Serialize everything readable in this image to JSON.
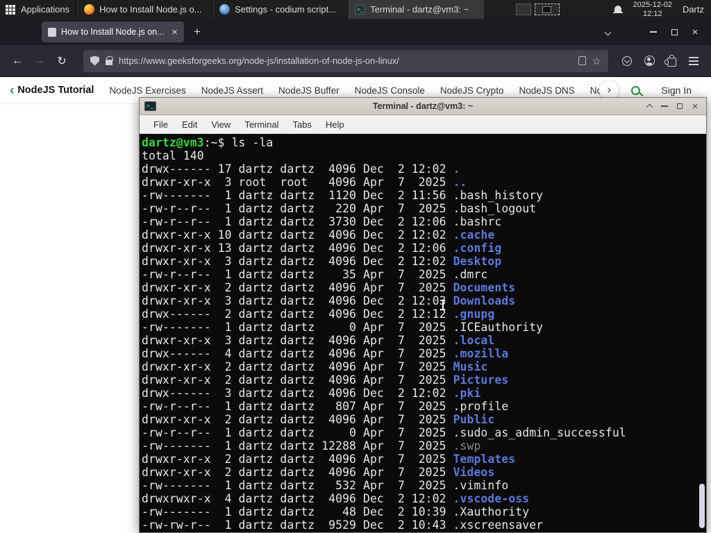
{
  "panel": {
    "applications": "Applications",
    "tasks": [
      {
        "icon": "firefox",
        "label": "How to Install Node.js o...",
        "active": false
      },
      {
        "icon": "settings",
        "label": "Settings - codium script...",
        "active": false
      },
      {
        "icon": "terminal",
        "label": "Terminal - dartz@vm3: ~",
        "active": true
      }
    ],
    "date": "2025-12-02",
    "time": "12:12",
    "user": "Dartz"
  },
  "browser": {
    "tab": {
      "title": "How to Install Node.js on..."
    },
    "url": "https://www.geeksforgeeks.org/node-js/installation-of-node-js-on-linux/"
  },
  "gfg_nav": {
    "back": "NodeJS Tutorial",
    "links": [
      "NodeJS Exercises",
      "NodeJS Assert",
      "NodeJS Buffer",
      "NodeJS Console",
      "NodeJS Crypto",
      "NodeJS DNS",
      "Node"
    ],
    "sign_in": "Sign In"
  },
  "terminal": {
    "title": "Terminal - dartz@vm3: ~",
    "menus": [
      "File",
      "Edit",
      "View",
      "Terminal",
      "Tabs",
      "Help"
    ],
    "lines": [
      [
        [
          "dartz@vm3",
          "green"
        ],
        [
          ":~$ ",
          "white"
        ],
        [
          "ls -la",
          "white"
        ]
      ],
      [
        [
          "total 140",
          "white"
        ]
      ],
      [
        [
          "drwx------ 17 dartz dartz  4096 Dec  2 12:02 ",
          "white"
        ],
        [
          ".",
          "blue"
        ]
      ],
      [
        [
          "drwxr-xr-x  3 root  root   4096 Apr  7  2025 ",
          "white"
        ],
        [
          "..",
          "blue"
        ]
      ],
      [
        [
          "-rw-------  1 dartz dartz  1120 Dec  2 11:56 .bash_history",
          "white"
        ]
      ],
      [
        [
          "-rw-r--r--  1 dartz dartz   220 Apr  7  2025 .bash_logout",
          "white"
        ]
      ],
      [
        [
          "-rw-r--r--  1 dartz dartz  3730 Dec  2 12:06 .bashrc",
          "white"
        ]
      ],
      [
        [
          "drwxr-xr-x 10 dartz dartz  4096 Dec  2 12:02 ",
          "white"
        ],
        [
          ".cache",
          "blue"
        ]
      ],
      [
        [
          "drwxr-xr-x 13 dartz dartz  4096 Dec  2 12:06 ",
          "white"
        ],
        [
          ".config",
          "blue"
        ]
      ],
      [
        [
          "drwxr-xr-x  3 dartz dartz  4096 Dec  2 12:02 ",
          "white"
        ],
        [
          "Desktop",
          "blue"
        ]
      ],
      [
        [
          "-rw-r--r--  1 dartz dartz    35 Apr  7  2025 .dmrc",
          "white"
        ]
      ],
      [
        [
          "drwxr-xr-x  2 dartz dartz  4096 Apr  7  2025 ",
          "white"
        ],
        [
          "Documents",
          "blue"
        ]
      ],
      [
        [
          "drwxr-xr-x  3 dartz dartz  4096 Dec  2 12:03 ",
          "white"
        ],
        [
          "Downloads",
          "blue"
        ]
      ],
      [
        [
          "drwx------  2 dartz dartz  4096 Dec  2 12:12 ",
          "white"
        ],
        [
          ".gnupg",
          "blue"
        ]
      ],
      [
        [
          "-rw-------  1 dartz dartz     0 Apr  7  2025 .ICEauthority",
          "white"
        ]
      ],
      [
        [
          "drwxr-xr-x  3 dartz dartz  4096 Apr  7  2025 ",
          "white"
        ],
        [
          ".local",
          "blue"
        ]
      ],
      [
        [
          "drwx------  4 dartz dartz  4096 Apr  7  2025 ",
          "white"
        ],
        [
          ".mozilla",
          "blue"
        ]
      ],
      [
        [
          "drwxr-xr-x  2 dartz dartz  4096 Apr  7  2025 ",
          "white"
        ],
        [
          "Music",
          "blue"
        ]
      ],
      [
        [
          "drwxr-xr-x  2 dartz dartz  4096 Apr  7  2025 ",
          "white"
        ],
        [
          "Pictures",
          "blue"
        ]
      ],
      [
        [
          "drwx------  3 dartz dartz  4096 Dec  2 12:02 ",
          "white"
        ],
        [
          ".pki",
          "blue"
        ]
      ],
      [
        [
          "-rw-r--r--  1 dartz dartz   807 Apr  7  2025 .profile",
          "white"
        ]
      ],
      [
        [
          "drwxr-xr-x  2 dartz dartz  4096 Apr  7  2025 ",
          "white"
        ],
        [
          "Public",
          "blue"
        ]
      ],
      [
        [
          "-rw-r--r--  1 dartz dartz     0 Apr  7  2025 .sudo_as_admin_successful",
          "white"
        ]
      ],
      [
        [
          "-rw-------  1 dartz dartz 12288 Apr  7  2025 ",
          "white"
        ],
        [
          ".swp",
          "gray"
        ]
      ],
      [
        [
          "drwxr-xr-x  2 dartz dartz  4096 Apr  7  2025 ",
          "white"
        ],
        [
          "Templates",
          "blue"
        ]
      ],
      [
        [
          "drwxr-xr-x  2 dartz dartz  4096 Apr  7  2025 ",
          "white"
        ],
        [
          "Videos",
          "blue"
        ]
      ],
      [
        [
          "-rw-------  1 dartz dartz   532 Apr  7  2025 .viminfo",
          "white"
        ]
      ],
      [
        [
          "drwxrwxr-x  4 dartz dartz  4096 Dec  2 12:02 ",
          "white"
        ],
        [
          ".vscode-oss",
          "blue"
        ]
      ],
      [
        [
          "-rw-------  1 dartz dartz    48 Dec  2 10:39 .Xauthority",
          "white"
        ]
      ],
      [
        [
          "-rw-rw-r--  1 dartz dartz  9529 Dec  2 10:43 .xscreensaver",
          "white"
        ]
      ]
    ]
  },
  "colors": {
    "gfg_green": "#2f8d46",
    "terminal_green": "#3cd63c",
    "terminal_blue": "#5e79d8",
    "terminal_dim": "#8a8a8a"
  }
}
